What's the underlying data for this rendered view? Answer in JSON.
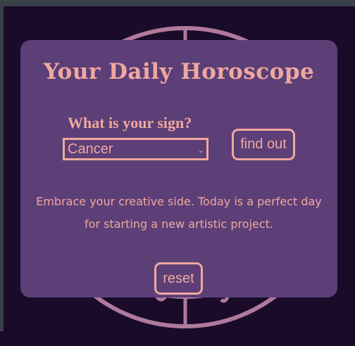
{
  "app": {
    "title": "Your Daily Horoscope"
  },
  "form": {
    "question": "What is your sign?",
    "selected_sign": "Cancer",
    "find_button": "find out"
  },
  "result": {
    "horoscope": "Embrace your creative side. Today is a perfect day for starting a new artistic project."
  },
  "actions": {
    "reset_button": "reset"
  },
  "colors": {
    "background": "#1a0b2a",
    "card": "#5c3f77",
    "accent": "#f0a89e"
  },
  "icons": {
    "dropdown": "chevron-down-icon",
    "background_art": "zodiac-wheel-icon"
  }
}
